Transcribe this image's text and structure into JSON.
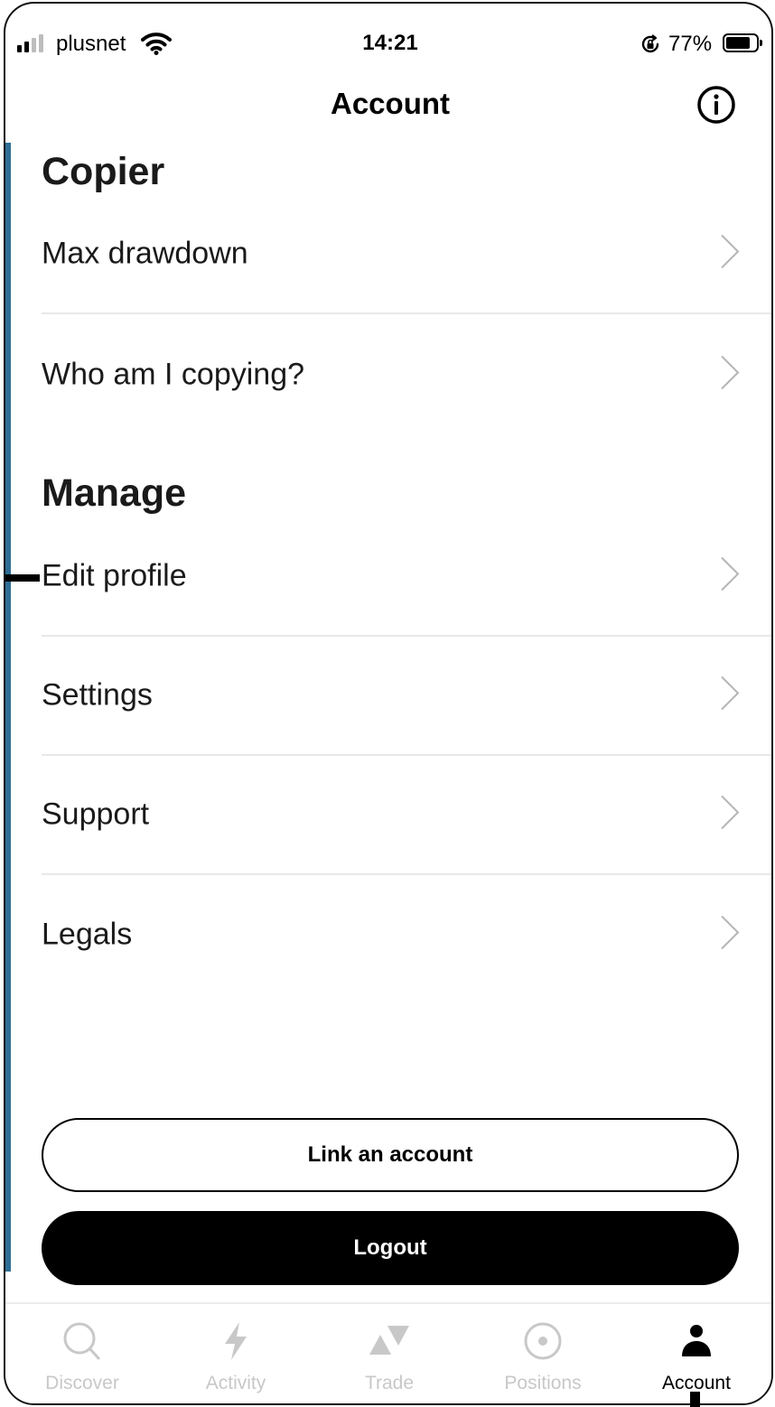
{
  "status_bar": {
    "carrier": "plusnet",
    "time": "14:21",
    "battery_percent": "77%",
    "signal_bars": 4,
    "signal_bars_active": 2,
    "battery_level": 0.77
  },
  "nav": {
    "title": "Account",
    "info_icon": "info-circle-icon"
  },
  "sections": [
    {
      "title": "Copier",
      "items": [
        {
          "label": "Max drawdown",
          "icon": "chevron-right-icon"
        },
        {
          "label": "Who am I copying?",
          "icon": "chevron-right-icon"
        }
      ]
    },
    {
      "title": "Manage",
      "items": [
        {
          "label": "Edit profile",
          "icon": "chevron-right-icon"
        },
        {
          "label": "Settings",
          "icon": "chevron-right-icon"
        },
        {
          "label": "Support",
          "icon": "chevron-right-icon"
        },
        {
          "label": "Legals",
          "icon": "chevron-right-icon"
        }
      ]
    }
  ],
  "buttons": {
    "link_account": "Link an account",
    "logout": "Logout"
  },
  "tabs": [
    {
      "label": "Discover",
      "icon": "search-icon",
      "active": false
    },
    {
      "label": "Activity",
      "icon": "lightning-icon",
      "active": false
    },
    {
      "label": "Trade",
      "icon": "trade-triangles-icon",
      "active": false
    },
    {
      "label": "Positions",
      "icon": "target-icon",
      "active": false
    },
    {
      "label": "Account",
      "icon": "person-icon",
      "active": true
    }
  ],
  "colors": {
    "accent_bar": "#2f6e95",
    "text_primary": "#1a1a1a",
    "tab_inactive": "#c8c8c8",
    "divider": "#e8e8e8"
  }
}
